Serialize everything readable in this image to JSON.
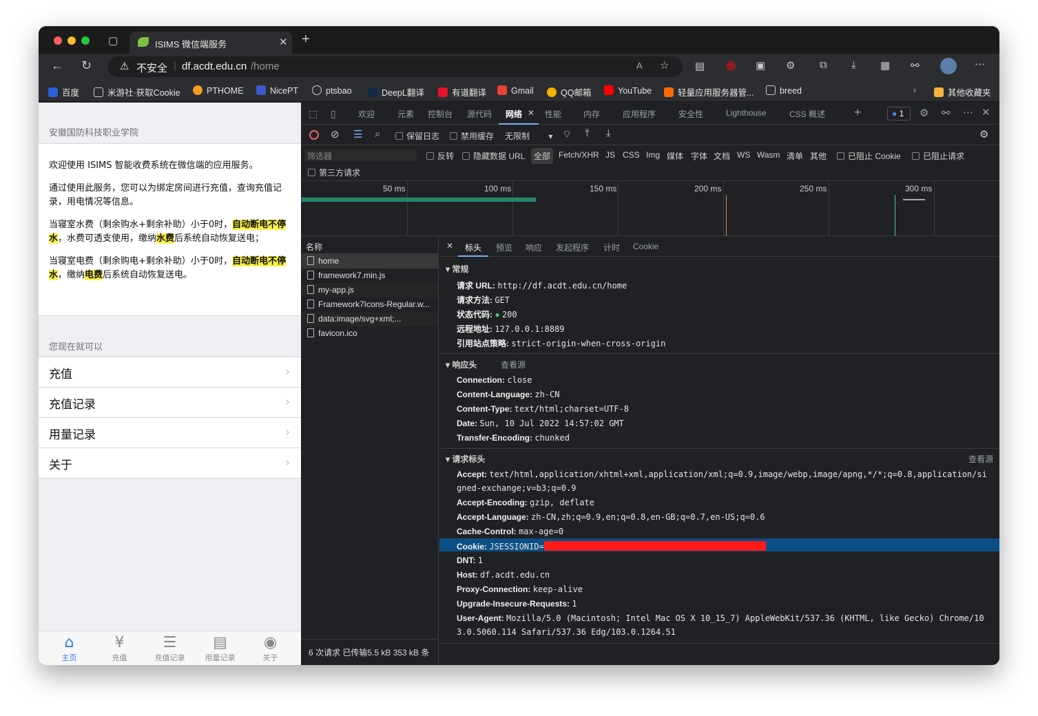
{
  "browser": {
    "tab_title": "ISIMS 微信端服务",
    "security_label": "不安全",
    "url_host": "df.acdt.edu.cn",
    "url_path": "/home",
    "bookmarks": [
      "百度",
      "米游社·获取Cookie",
      "PTHOME",
      "NicePT",
      "ptsbao",
      "DeepL翻译",
      "有道翻译",
      "Gmail",
      "QQ邮箱",
      "YouTube",
      "轻量应用服务器管...",
      "breed"
    ],
    "other_bookmarks": "其他收藏夹"
  },
  "page": {
    "header": "安徽国防科技职业学院",
    "intro": "欢迎使用 ISIMS 智能收费系统在微信端的应用服务。",
    "desc": "通过使用此服务，您可以为绑定房间进行充值，查询充值记录，用电情况等信息。",
    "water_a": "当寝室水费（剩余购水+剩余补助）小于0时，",
    "water_hl": "自动断电不停水",
    "water_b": "，水费可透支使用，缴纳",
    "water_hl2": "水费",
    "water_c": "后系统自动恢复送电；",
    "elec_a": "当寝室电费（剩余购电+剩余补助）小于0时，",
    "elec_hl": "自动断电不停水",
    "elec_b": "，缴纳",
    "elec_hl2": "电费",
    "elec_c": "后系统自动恢复送电。",
    "sub_header": "您现在就可以",
    "menu": [
      "充值",
      "充值记录",
      "用量记录",
      "关于"
    ],
    "tabbar": [
      "主页",
      "充值",
      "充值记录",
      "用量记录",
      "关于"
    ]
  },
  "devtools": {
    "tabs": [
      "欢迎",
      "元素",
      "控制台",
      "源代码",
      "网络",
      "性能",
      "内存",
      "应用程序",
      "安全性",
      "Lighthouse",
      "CSS 概述"
    ],
    "issues_count": "1",
    "toolbar": {
      "preserve_log": "保留日志",
      "disable_cache": "禁用缓存",
      "throttle": "无限制"
    },
    "filter": {
      "placeholder": "筛选器",
      "invert": "反转",
      "hide_data": "隐藏数据 URL",
      "types": [
        "全部",
        "Fetch/XHR",
        "JS",
        "CSS",
        "Img",
        "媒体",
        "字体",
        "文档",
        "WS",
        "Wasm",
        "清单",
        "其他"
      ],
      "blocked_cookie": "已阻止 Cookie",
      "blocked_req": "已阻止请求",
      "third_party": "第三方请求"
    },
    "timeline_ticks": [
      "50 ms",
      "100 ms",
      "150 ms",
      "200 ms",
      "250 ms",
      "300 ms"
    ],
    "name_header": "名称",
    "requests": [
      "home",
      "framework7.min.js",
      "my-app.js",
      "Framework7Icons-Regular.w...",
      "data:image/svg+xml;...",
      "favicon.ico"
    ],
    "status_bar": "6 次请求  已传输5.5 kB  353 kB 条",
    "detail_tabs": [
      "标头",
      "预览",
      "响应",
      "发起程序",
      "计时",
      "Cookie"
    ],
    "general_title": "常规",
    "general": [
      {
        "k": "请求 URL:",
        "v": "http://df.acdt.edu.cn/home"
      },
      {
        "k": "请求方法:",
        "v": "GET"
      },
      {
        "k": "状态代码:",
        "v": "200"
      },
      {
        "k": "远程地址:",
        "v": "127.0.0.1:8889"
      },
      {
        "k": "引用站点策略:",
        "v": "strict-origin-when-cross-origin"
      }
    ],
    "resp_title": "响应头",
    "view_source": "查看源",
    "resp_headers": [
      {
        "k": "Connection:",
        "v": "close"
      },
      {
        "k": "Content-Language:",
        "v": "zh-CN"
      },
      {
        "k": "Content-Type:",
        "v": "text/html;charset=UTF-8"
      },
      {
        "k": "Date:",
        "v": "Sun, 10 Jul 2022 14:57:02 GMT"
      },
      {
        "k": "Transfer-Encoding:",
        "v": "chunked"
      }
    ],
    "req_title": "请求标头",
    "req_headers": [
      {
        "k": "Accept:",
        "v": "text/html,application/xhtml+xml,application/xml;q=0.9,image/webp,image/apng,*/*;q=0.8,application/si"
      },
      {
        "k": "",
        "v": "gned-exchange;v=b3;q=0.9"
      },
      {
        "k": "Accept-Encoding:",
        "v": "gzip, deflate"
      },
      {
        "k": "Accept-Language:",
        "v": "zh-CN,zh;q=0.9,en;q=0.8,en-GB;q=0.7,en-US;q=0.6"
      },
      {
        "k": "Cache-Control:",
        "v": "max-age=0"
      },
      {
        "k": "Cookie:",
        "v": "JSESSIONID="
      },
      {
        "k": "DNT:",
        "v": "1"
      },
      {
        "k": "Host:",
        "v": "df.acdt.edu.cn"
      },
      {
        "k": "Proxy-Connection:",
        "v": "keep-alive"
      },
      {
        "k": "Upgrade-Insecure-Requests:",
        "v": "1"
      },
      {
        "k": "User-Agent:",
        "v": "Mozilla/5.0 (Macintosh; Intel Mac OS X 10_15_7) AppleWebKit/537.36 (KHTML, like Gecko) Chrome/10"
      },
      {
        "k": "",
        "v": "3.0.5060.114 Safari/537.36 Edg/103.0.1264.51"
      }
    ]
  }
}
